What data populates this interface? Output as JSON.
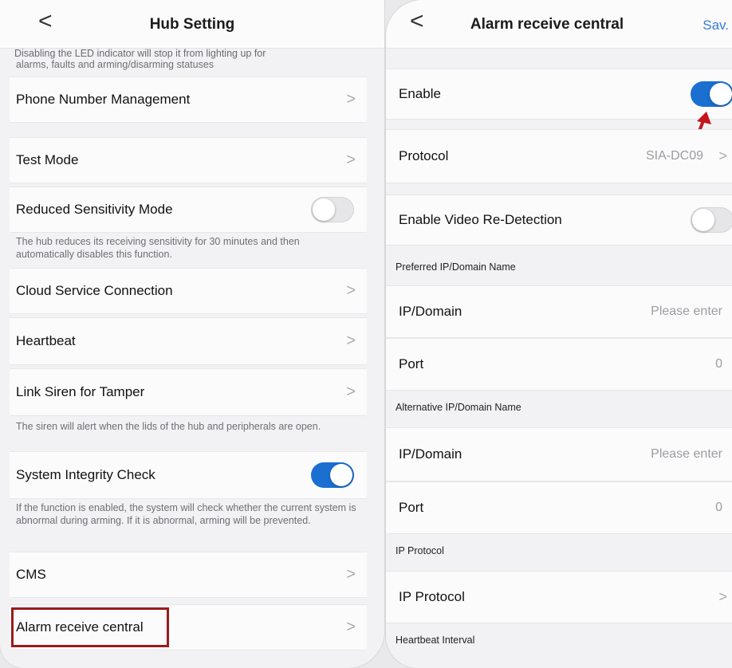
{
  "left": {
    "title": "Hub Setting",
    "back_glyph": "<",
    "cut_text": "Disabling the LED indicator will stop it from lighting up for",
    "cut_text2": "alarms, faults and arming/disarming statuses",
    "rows": {
      "phone": "Phone Number Management",
      "test": "Test Mode",
      "reduced": "Reduced Sensitivity Mode",
      "cloud": "Cloud Service Connection",
      "heartbeat": "Heartbeat",
      "siren": "Link Siren for Tamper",
      "integrity": "System Integrity Check",
      "cms": "CMS",
      "alarm": "Alarm receive central"
    },
    "notes": {
      "reduced": "The hub reduces its receiving sensitivity for 30 minutes and then automatically disables this function.",
      "siren": "The siren will alert when the lids of the hub and peripherals are open.",
      "integrity": "If the function is enabled, the system will check whether the current system is abnormal during arming. If it is abnormal, arming will be prevented."
    },
    "chevron": ">"
  },
  "right": {
    "title": "Alarm receive central",
    "save_label": "Sav.",
    "back_glyph": "<",
    "rows": {
      "enable": "Enable",
      "protocol": "Protocol",
      "protocol_value": "SIA-DC09",
      "video": "Enable Video Re-Detection",
      "ip1": "IP/Domain",
      "ip1_placeholder": "Please enter",
      "port1": "Port",
      "port1_value": "0",
      "ip2": "IP/Domain",
      "ip2_placeholder": "Please enter",
      "port2": "Port",
      "port2_value": "0",
      "ipproto": "IP Protocol"
    },
    "sections": {
      "preferred": "Preferred IP/Domain Name",
      "alternative": "Alternative IP/Domain Name",
      "ipproto": "IP Protocol",
      "heartbeat": "Heartbeat Interval"
    },
    "chevron": ">"
  },
  "colors": {
    "accent": "#1a6fd1",
    "highlight": "#9b1b1b",
    "arrow": "#c4161c"
  },
  "toggles": {
    "reduced": false,
    "integrity": true,
    "enable": true,
    "video": false
  }
}
